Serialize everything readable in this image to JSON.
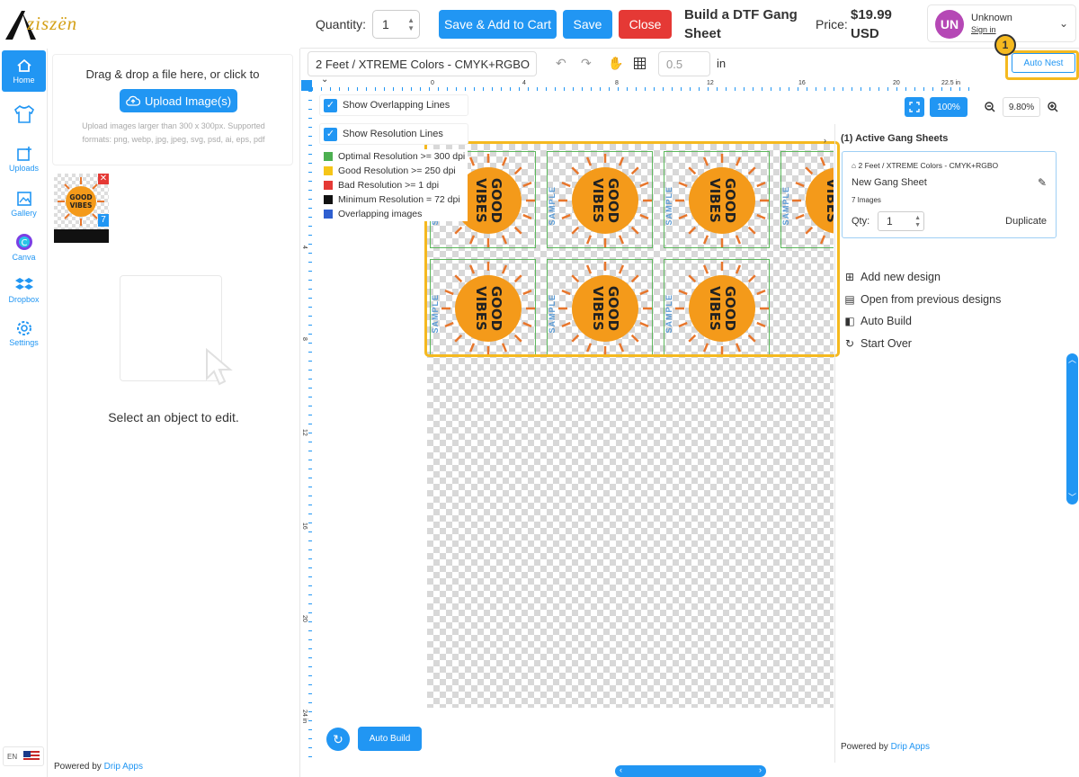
{
  "brand": {
    "logo_text": "ziszën"
  },
  "header": {
    "quantity_label": "Quantity:",
    "quantity_value": "1",
    "save_add_cart": "Save & Add to Cart",
    "save": "Save",
    "close": "Close",
    "build_title": "Build a DTF Gang Sheet",
    "price_label": "Price:",
    "price_value": "$19.99 USD",
    "user": {
      "initials": "UN",
      "name": "Unknown",
      "sign_in": "Sign in"
    }
  },
  "rail": {
    "items": [
      {
        "label": "Home",
        "icon": "home-icon"
      },
      {
        "label": "",
        "icon": "tshirt-icon"
      },
      {
        "label": "Uploads",
        "icon": "upload-icon"
      },
      {
        "label": "Gallery",
        "icon": "gallery-icon"
      },
      {
        "label": "Canva",
        "icon": "canva-icon"
      },
      {
        "label": "Dropbox",
        "icon": "dropbox-icon"
      },
      {
        "label": "Settings",
        "icon": "gear-icon"
      }
    ],
    "language": "EN"
  },
  "left_panel": {
    "drop_text": "Drag & drop a file here, or click to",
    "upload_button": "Upload Image(s)",
    "hint": "Upload images larger than 300 x 300px. Supported formats: png, webp, jpg, jpeg, svg, psd, ai, eps, pdf",
    "thumb_close": "✕",
    "thumb_count": "7",
    "select_text": "Select an object to edit.",
    "powered_prefix": "Powered by ",
    "powered_link": "Drip Apps"
  },
  "toolbar": {
    "sheet_select": "2 Feet / XTREME Colors - CMYK+RGBO",
    "step_value": "0.5",
    "unit": "in",
    "auto_nest": "Auto Nest",
    "badge": "1"
  },
  "rulers": {
    "h_ticks": [
      "0",
      "4",
      "8",
      "12",
      "16",
      "20",
      "22.5 in"
    ],
    "v_ticks": [
      "4",
      "8",
      "12",
      "16",
      "20",
      "24 in"
    ]
  },
  "overlay": {
    "show_overlapping": "Show Overlapping Lines",
    "show_resolution": "Show Resolution Lines",
    "legend": [
      {
        "label": "Optimal Resolution >= 300 dpi",
        "color": "#4caf50"
      },
      {
        "label": "Good Resolution >= 250 dpi",
        "color": "#f5c518"
      },
      {
        "label": "Bad Resolution >= 1 dpi",
        "color": "#e53935"
      },
      {
        "label": "Minimum Resolution = 72 dpi",
        "color": "#111111"
      },
      {
        "label": "Overlapping images",
        "color": "#2f5fd0"
      }
    ]
  },
  "canvas": {
    "design_text_line1": "GOOD",
    "design_text_line2": "VIBES",
    "watermark": "SAMPLE",
    "rows": [
      4,
      3
    ]
  },
  "zoom": {
    "reset": "100%",
    "percent": "9.80%"
  },
  "right_panel": {
    "title": "(1)  Active Gang Sheets",
    "sheet": {
      "type": "2 Feet / XTREME Colors - CMYK+RGBO",
      "name": "New Gang Sheet",
      "count": "7 Images",
      "qty_label": "Qty:",
      "qty_value": "1",
      "duplicate": "Duplicate"
    },
    "actions": [
      {
        "label": "Add new design",
        "icon": "add-design-icon"
      },
      {
        "label": "Open from previous designs",
        "icon": "open-designs-icon"
      },
      {
        "label": "Auto Build",
        "icon": "auto-build-icon"
      },
      {
        "label": "Start Over",
        "icon": "start-over-icon"
      }
    ],
    "powered_prefix": "Powered by ",
    "powered_link": "Drip Apps"
  },
  "bottom": {
    "auto_build": "Auto Build"
  },
  "colors": {
    "accent": "#2196f3",
    "danger": "#e53935",
    "highlight": "#f5b91f"
  }
}
